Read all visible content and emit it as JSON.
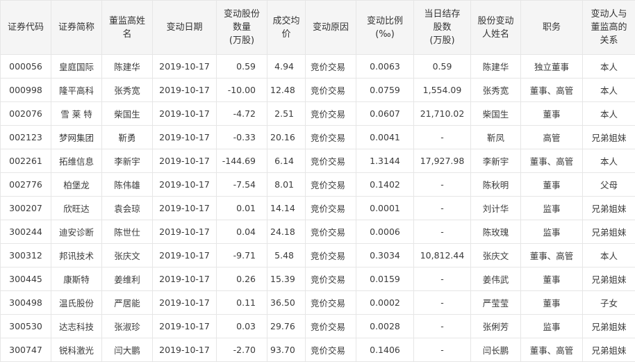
{
  "table": {
    "headers": [
      "证券代码",
      "证券简称",
      "董监高姓\n名",
      "变动日期",
      "变动股份\n数量\n(万股)",
      "成交均\n价",
      "变动原因",
      "变动比例\n(‰)",
      "当日结存\n股数\n(万股)",
      "股份变动\n人姓名",
      "职务",
      "变动人与\n董监高的\n关系"
    ],
    "rows": [
      [
        "000056",
        "皇庭国际",
        "陈建华",
        "2019-10-17",
        "0.59",
        "4.94",
        "竞价交易",
        "0.0063",
        "0.59",
        "陈建华",
        "独立董事",
        "本人"
      ],
      [
        "000998",
        "隆平高科",
        "张秀宽",
        "2019-10-17",
        "-10.00",
        "12.48",
        "竞价交易",
        "0.0759",
        "1,554.09",
        "张秀宽",
        "董事、高管",
        "本人"
      ],
      [
        "002076",
        "雪 莱 特",
        "柴国生",
        "2019-10-17",
        "-4.72",
        "2.51",
        "竞价交易",
        "0.0607",
        "21,710.02",
        "柴国生",
        "董事",
        "本人"
      ],
      [
        "002123",
        "梦网集团",
        "靳勇",
        "2019-10-17",
        "-0.33",
        "20.16",
        "竞价交易",
        "0.0041",
        "-",
        "靳凤",
        "高管",
        "兄弟姐妹"
      ],
      [
        "002261",
        "拓维信息",
        "李新宇",
        "2019-10-17",
        "-144.69",
        "6.14",
        "竞价交易",
        "1.3144",
        "17,927.98",
        "李新宇",
        "董事、高管",
        "本人"
      ],
      [
        "002776",
        "柏堡龙",
        "陈伟雄",
        "2019-10-17",
        "-7.54",
        "8.01",
        "竞价交易",
        "0.1402",
        "-",
        "陈秋明",
        "董事",
        "父母"
      ],
      [
        "300207",
        "欣旺达",
        "袁会琼",
        "2019-10-17",
        "0.01",
        "14.14",
        "竞价交易",
        "0.0001",
        "-",
        "刘计华",
        "监事",
        "兄弟姐妹"
      ],
      [
        "300244",
        "迪安诊断",
        "陈世仕",
        "2019-10-17",
        "0.04",
        "24.18",
        "竞价交易",
        "0.0006",
        "-",
        "陈玫瑰",
        "监事",
        "兄弟姐妹"
      ],
      [
        "300312",
        "邦讯技术",
        "张庆文",
        "2019-10-17",
        "-9.71",
        "5.48",
        "竞价交易",
        "0.3034",
        "10,812.44",
        "张庆文",
        "董事、高管",
        "本人"
      ],
      [
        "300445",
        "康斯特",
        "姜维利",
        "2019-10-17",
        "0.26",
        "15.39",
        "竞价交易",
        "0.0159",
        "-",
        "姜伟武",
        "董事",
        "兄弟姐妹"
      ],
      [
        "300498",
        "温氏股份",
        "严居能",
        "2019-10-17",
        "0.11",
        "36.50",
        "竞价交易",
        "0.0002",
        "-",
        "严莹莹",
        "董事",
        "子女"
      ],
      [
        "300530",
        "达志科技",
        "张淑珍",
        "2019-10-17",
        "0.03",
        "29.76",
        "竞价交易",
        "0.0028",
        "-",
        "张俐芳",
        "监事",
        "兄弟姐妹"
      ],
      [
        "300747",
        "锐科激光",
        "闫大鹏",
        "2019-10-17",
        "-2.70",
        "93.70",
        "竞价交易",
        "0.1406",
        "-",
        "闫长鹏",
        "董事、高管",
        "兄弟姐妹"
      ]
    ]
  }
}
